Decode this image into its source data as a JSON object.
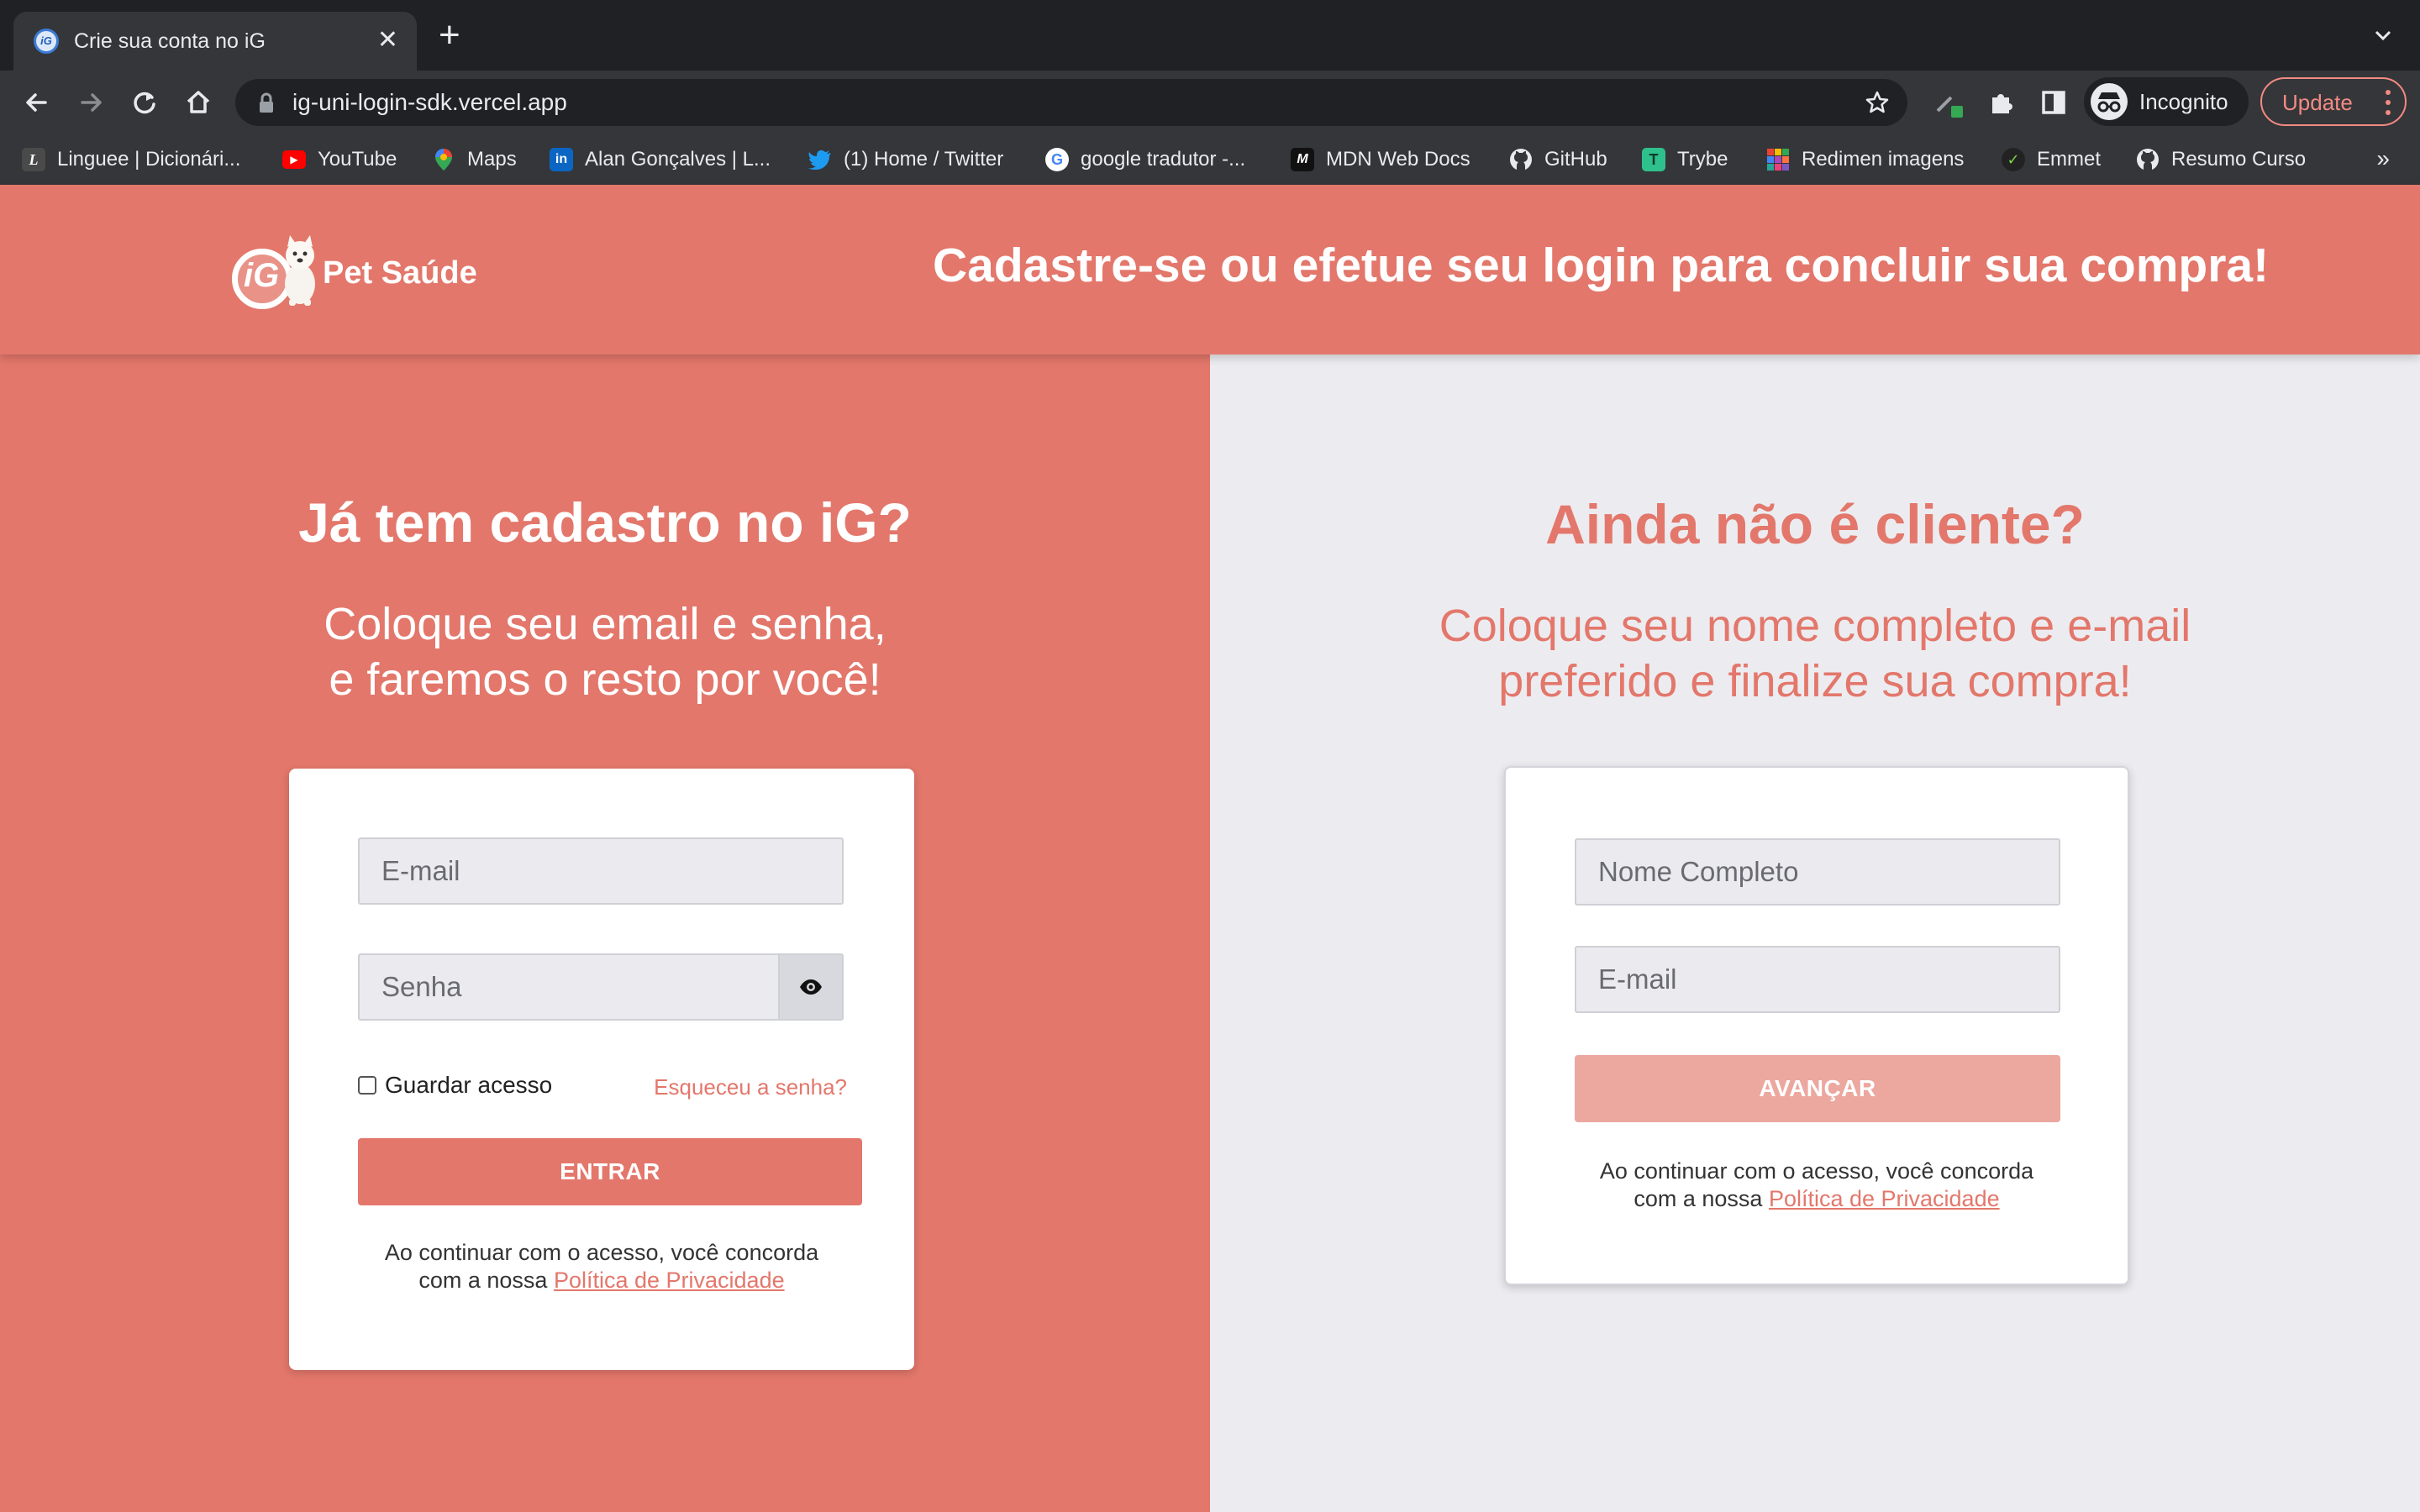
{
  "browser": {
    "tab_title": "Crie sua conta no iG",
    "tab_close": "✕",
    "new_tab": "+",
    "url": "ig-uni-login-sdk.vercel.app",
    "incognito_label": "Incognito",
    "update_label": "Update",
    "bookmarks_more": "»",
    "bookmarks": [
      {
        "label": "Linguee | Dicionári...",
        "icon": "linguee-icon",
        "color": "#4a4a4a",
        "glyph": "L"
      },
      {
        "label": "YouTube",
        "icon": "youtube-icon",
        "color": "#ff0000",
        "glyph": "▶"
      },
      {
        "label": "Maps",
        "icon": "maps-icon",
        "color": "#34a853",
        "glyph": "●"
      },
      {
        "label": "Alan Gonçalves | L...",
        "icon": "linkedin-icon",
        "color": "#0a66c2",
        "glyph": "in"
      },
      {
        "label": "(1) Home / Twitter",
        "icon": "twitter-icon",
        "color": "#1d9bf0",
        "glyph": "✦"
      },
      {
        "label": "google tradutor -...",
        "icon": "google-icon",
        "color": "#ffffff",
        "glyph": "G"
      },
      {
        "label": "MDN Web Docs",
        "icon": "mdn-icon",
        "color": "#111111",
        "glyph": "M"
      },
      {
        "label": "GitHub",
        "icon": "github-icon",
        "color": "#e8eaed",
        "glyph": "●"
      },
      {
        "label": "Trybe",
        "icon": "trybe-icon",
        "color": "#2fc18c",
        "glyph": "T"
      },
      {
        "label": "Redimen imagens",
        "icon": "redimen-icon",
        "color": "#f4b400",
        "glyph": "▦"
      },
      {
        "label": "Emmet",
        "icon": "emmet-icon",
        "color": "#222222",
        "glyph": "✓"
      },
      {
        "label": "Resumo Curso",
        "icon": "github-icon",
        "color": "#e8eaed",
        "glyph": "●"
      }
    ]
  },
  "header": {
    "logo_text": "Pet Saúde",
    "logo_mark": "iG",
    "title": "Cadastre-se ou efetue seu login para concluir sua compra!"
  },
  "login": {
    "heading": "Já tem cadastro no iG?",
    "sub_line1": "Coloque seu email e senha,",
    "sub_line2": "e faremos o resto por você!",
    "email_placeholder": "E-mail",
    "password_placeholder": "Senha",
    "remember_label": "Guardar acesso",
    "forgot_label": "Esqueceu a senha?",
    "submit_label": "ENTRAR",
    "terms_line1": "Ao continuar com o acesso, você concorda",
    "terms_prefix": "com a nossa ",
    "terms_link": "Política de Privacidade"
  },
  "signup": {
    "heading": "Ainda não é cliente?",
    "sub_line1": "Coloque seu nome completo e e-mail",
    "sub_line2": "preferido e finalize sua compra!",
    "name_placeholder": "Nome Completo",
    "email_placeholder": "E-mail",
    "submit_label": "AVANÇAR",
    "terms_line1": "Ao continuar com o acesso, você concorda",
    "terms_prefix": "com a nossa ",
    "terms_link": "Política de Privacidade"
  },
  "colors": {
    "brand": "#e3776b",
    "brand_disabled": "#eca79f",
    "panel_light": "#ececf0",
    "chrome_dark": "#202124",
    "chrome": "#35363a"
  }
}
